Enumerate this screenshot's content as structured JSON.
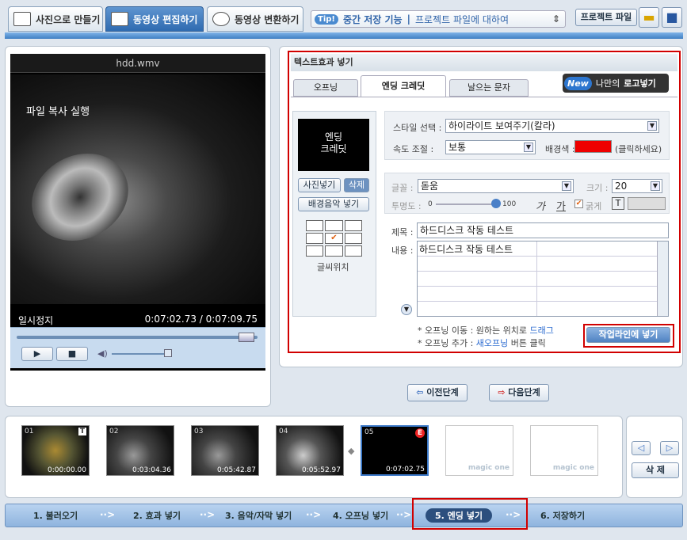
{
  "tabs": [
    {
      "label": "사진으로 만들기"
    },
    {
      "label": "동영상 편집하기"
    },
    {
      "label": "동영상 변환하기"
    }
  ],
  "tip": {
    "badge": "Tip!",
    "text": "중간 저장 기능",
    "sep": "|",
    "text2": "프로젝트 파일에 대하여"
  },
  "project_file": "프로젝트 파일",
  "player": {
    "filename": "hdd.wmv",
    "overlay": "파일 복사 실행",
    "status": "일시정지",
    "timecode": "0:07:02.73 / 0:07:09.75"
  },
  "editor": {
    "title": "텍스트효과 넣기",
    "tabs": [
      "오프닝",
      "엔딩 크레딧",
      "날으는 문자"
    ],
    "logo_btn": {
      "badge": "New",
      "prefix": "나만의",
      "label": "로고넣기"
    },
    "preview_text": "엔딩\n크레딧",
    "add_photo": "사진넣기",
    "delete": "삭제",
    "bgm": "배경음악 넣기",
    "text_pos": "글씨위치",
    "style_label": "스타일 선택 :",
    "style_value": "하이라이트 보여주기(칼라)",
    "speed_label": "속도 조절 :",
    "speed_value": "보통",
    "bg_label": "배경색 :",
    "bg_hint": "(클릭하세요)",
    "bg_color": "#ee0000",
    "font_label": "글꼴 :",
    "font_value": "돋움",
    "size_label": "크기 :",
    "size_value": "20",
    "opacity_label": "투명도 :",
    "opacity_min": "0",
    "opacity_max": "100",
    "italic": "가",
    "underline": "가",
    "bold": "굵게",
    "text_icon": "T",
    "title_label": "제목 :",
    "title_value": "하드디스크 작동 테스트",
    "content_label": "내용 :",
    "content_value": "하드디스크 작동 테스트",
    "help1a": "* 오프닝 이동 : 원하는 위치로 ",
    "help1b": "드래그",
    "help2a": "* 오프닝 추가 : ",
    "help2b": "새오프닝",
    "help2c": " 버튼 클릭",
    "timeline_btn": "작업라인에 넣기"
  },
  "nav": {
    "prev": "이전단계",
    "next": "다음단계"
  },
  "thumbs": [
    {
      "num": "01",
      "tc": "0:00:00.00"
    },
    {
      "num": "02",
      "tc": "0:03:04.36"
    },
    {
      "num": "03",
      "tc": "0:05:42.87"
    },
    {
      "num": "04",
      "tc": "0:05:52.97"
    },
    {
      "num": "05",
      "tc": "0:07:02.75"
    }
  ],
  "empty_label": "magic one",
  "timeline_delete": "삭 제",
  "steps": [
    "1. 불러오기",
    "2. 효과 넣기",
    "3. 음악/자막 넣기",
    "4. 오프닝 넣기",
    "5. 엔딩 넣기",
    "6. 저장하기"
  ],
  "arrow_glyph": "··>"
}
